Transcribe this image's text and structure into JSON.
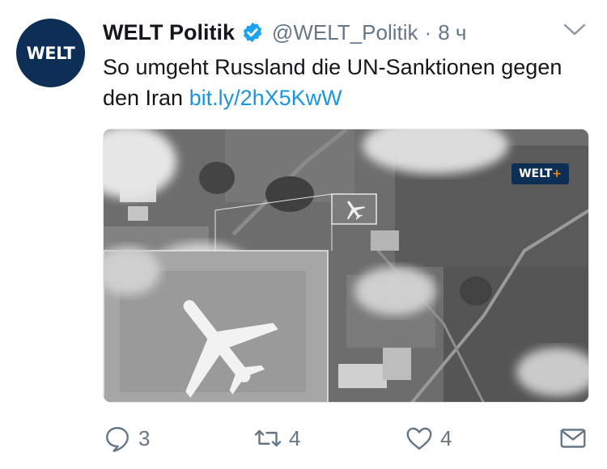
{
  "account": {
    "avatar_text": "WELT",
    "name": "WELT Politik",
    "handle": "@WELT_Politik",
    "separator": "·",
    "time": "8 ч"
  },
  "tweet": {
    "text": "So umgeht Russland die UN-Sanktionen gegen den Iran ",
    "link": "bit.ly/2hX5KwW"
  },
  "media": {
    "badge_main": "WELT",
    "badge_plus": "+"
  },
  "actions": {
    "reply_count": "3",
    "retweet_count": "4",
    "like_count": "4"
  },
  "colors": {
    "brand": "#0d2f55",
    "link": "#1b95e0",
    "verified": "#1da1f2",
    "muted": "#657786"
  },
  "icons": [
    "verified-icon",
    "chevron-down-icon",
    "reply-icon",
    "retweet-icon",
    "like-icon",
    "direct-message-icon"
  ]
}
